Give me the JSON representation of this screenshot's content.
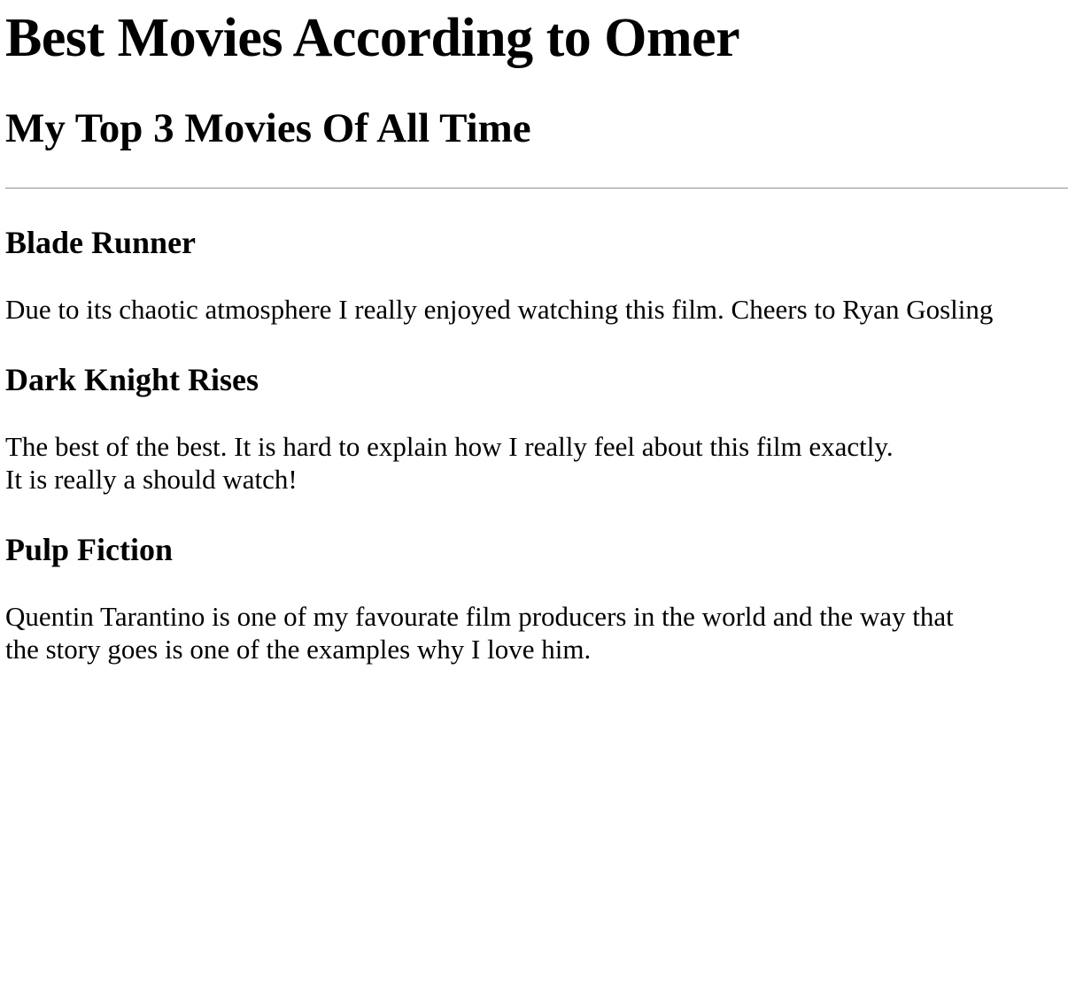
{
  "page": {
    "title": "Best Movies According to Omer",
    "subtitle": "My Top 3 Movies Of All Time"
  },
  "movies": [
    {
      "name": "Blade Runner",
      "description_lines": [
        "Due to its chaotic atmosphere I really enjoyed watching this film. Cheers to Ryan Gosling"
      ]
    },
    {
      "name": "Dark Knight Rises",
      "description_lines": [
        "The best of the best. It is hard to explain how I really feel about this film exactly.",
        "It is really a should watch!"
      ]
    },
    {
      "name": "Pulp Fiction",
      "description_lines": [
        "Quentin Tarantino is one of my favourate film producers in the world and the way that",
        "the story goes is one of the examples why I love him."
      ]
    }
  ]
}
